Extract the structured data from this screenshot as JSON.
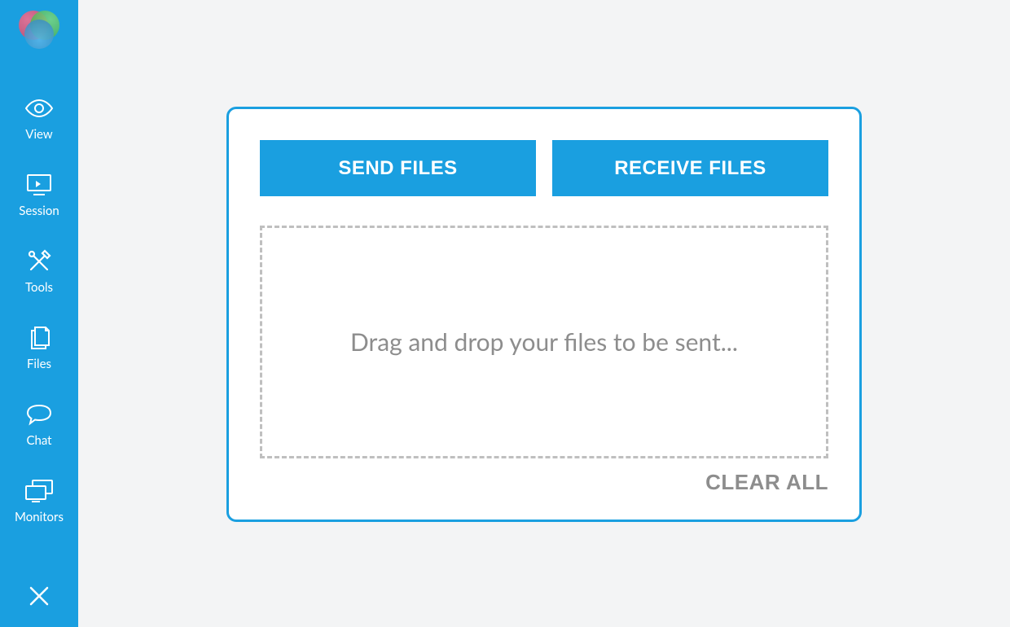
{
  "sidebar": {
    "items": [
      {
        "label": "View"
      },
      {
        "label": "Session"
      },
      {
        "label": "Tools"
      },
      {
        "label": "Files"
      },
      {
        "label": "Chat"
      },
      {
        "label": "Monitors"
      }
    ]
  },
  "panel": {
    "send_label": "SEND FILES",
    "receive_label": "RECEIVE FILES",
    "dropzone_text": "Drag and drop your files to be sent...",
    "clear_label": "CLEAR ALL"
  },
  "colors": {
    "accent": "#1a9fe0"
  }
}
